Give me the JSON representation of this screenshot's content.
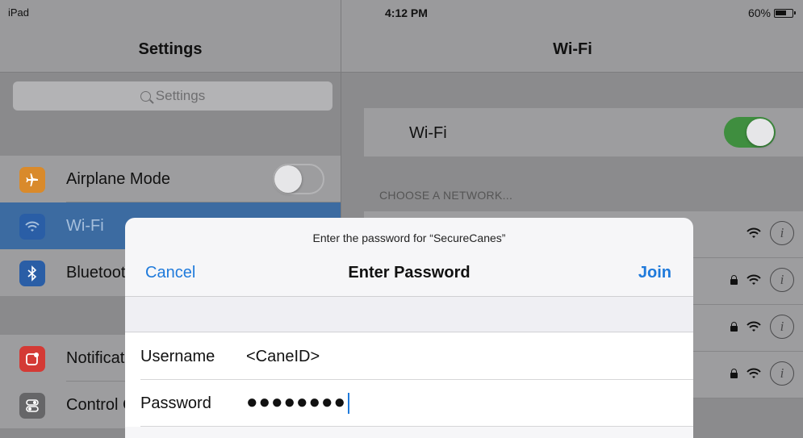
{
  "status_bar": {
    "carrier": "iPad",
    "time": "4:12 PM",
    "battery": "60%",
    "battery_level": 0.6
  },
  "settings": {
    "title": "Settings",
    "search_placeholder": "Settings",
    "items": [
      {
        "label": "Airplane Mode",
        "icon": "airplane-icon",
        "icon_color": "#d98a2b",
        "toggle": "off"
      },
      {
        "label": "Wi-Fi",
        "icon": "wifi-icon",
        "icon_color": "#2a5ea6",
        "selected": true
      },
      {
        "label": "Bluetooth",
        "icon": "bluetooth-icon",
        "icon_color": "#2a5ea6"
      },
      {
        "label": "Notifications",
        "icon": "notifications-icon",
        "icon_color": "#d43a35"
      },
      {
        "label": "Control Center",
        "icon": "control-center-icon",
        "icon_color": "#666668"
      }
    ]
  },
  "wifi": {
    "title": "Wi-Fi",
    "row_label": "Wi-Fi",
    "enabled": true,
    "section_header": "CHOOSE A NETWORK...",
    "networks": [
      {
        "locked": false
      },
      {
        "locked": true
      },
      {
        "locked": true
      },
      {
        "locked": true
      }
    ]
  },
  "dialog": {
    "prompt": "Enter the password for “SecureCanes”",
    "title": "Enter Password",
    "cancel": "Cancel",
    "join": "Join",
    "username_label": "Username",
    "username_value": "<CaneID>",
    "password_label": "Password",
    "password_value": "●●●●●●●●"
  },
  "colors": {
    "accent": "#1f7adb",
    "toggle_on": "#3f8e3f",
    "selected_row": "#3c6ba1"
  }
}
